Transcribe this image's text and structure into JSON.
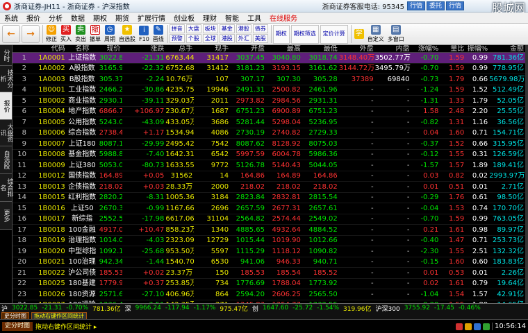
{
  "window": {
    "title": "浙商证券-JH11 - 浙商证券 - 沪深指数",
    "hotline": "浙商证券客服电话: 95345",
    "buttons": [
      "行情",
      "委托",
      "行情"
    ],
    "logo": "股城网"
  },
  "menubar": [
    "系统",
    "报价",
    "分析",
    "数据",
    "期权",
    "期货",
    "扩展行情",
    "创业板",
    "理财",
    "智能",
    "工具",
    "在线服务"
  ],
  "toolbar": {
    "big": [
      {
        "label": "←"
      },
      {
        "label": "→"
      }
    ],
    "icons": [
      {
        "label": "修正",
        "glyph": "☺",
        "color": "#f4a000"
      },
      {
        "label": "买入",
        "glyph": "买",
        "color": "#e02020"
      },
      {
        "label": "卖出",
        "glyph": "卖",
        "color": "#209020"
      },
      {
        "label": "撤单",
        "glyph": "撤",
        "color": "#ffffff"
      },
      {
        "label": "周期",
        "glyph": "◷",
        "color": "#2060c0"
      },
      {
        "label": "自选股",
        "glyph": "★",
        "color": "#f0c000"
      },
      {
        "label": "F10",
        "glyph": "i",
        "color": "#2060c0"
      },
      {
        "label": "画线",
        "glyph": "✎",
        "color": "#2060c0"
      }
    ],
    "pairs": [
      [
        "拼音",
        "预警"
      ],
      [
        "大盘",
        "个股"
      ],
      [
        "板块",
        "全球"
      ],
      [
        "基金",
        "港股"
      ],
      [
        "港股",
        "外汇"
      ],
      [
        "债券",
        "美股"
      ]
    ],
    "boxes": [
      "期权",
      "期权筛选",
      "定价计算"
    ],
    "tail": [
      {
        "label": "学",
        "glyph": "学"
      },
      {
        "label": "自定义",
        "glyph": "▦"
      },
      {
        "label": "多窗口",
        "glyph": "▤"
      }
    ]
  },
  "sidebar": [
    "分时",
    "技术分析",
    "报价",
    "大盘资讯",
    "自选股",
    "综合排名",
    "更多"
  ],
  "columns": [
    "",
    "代码",
    "名称",
    "现价",
    "涨跌",
    "总手",
    "现手",
    "开盘",
    "最高",
    "最低",
    "外盘",
    "内盘",
    "涨幅%",
    "量比",
    "振幅%",
    "金额"
  ],
  "rows": [
    [
      "1",
      "1A0001",
      "上证指数",
      "3022.85",
      "-21.31",
      "6763.44万",
      "31417",
      "3037.45",
      "3040.80",
      "3018.74",
      "3148.40万",
      "3502.77万",
      "-0.70",
      "1.59",
      "0.99",
      "781.36亿"
    ],
    [
      "2",
      "1A0002",
      "A股指数",
      "3165.94",
      "-22.32",
      "6752.68万",
      "31412",
      "3181.23",
      "3193.15",
      "3161.62",
      "3144.72万",
      "3495.79万",
      "-0.70",
      "1.59",
      "0.99",
      "778.95亿"
    ],
    [
      "3",
      "1A0003",
      "B股指数",
      "305.37",
      "-2.24",
      "10.76万",
      "107",
      "307.17",
      "307.30",
      "305.28",
      "37389",
      "69840",
      "-0.73",
      "1.79",
      "0.66",
      "5679.98万"
    ],
    [
      "4",
      "1B0001",
      "工业指数",
      "2466.22",
      "-30.86",
      "4235.75万",
      "19946",
      "2491.31",
      "2500.82",
      "2461.96",
      "-",
      "-",
      "-1.24",
      "1.59",
      "1.52",
      "512.49亿"
    ],
    [
      "5",
      "1B0002",
      "商业指数",
      "2930.18",
      "-39.11",
      "329.03万",
      "2011",
      "2973.82",
      "2984.56",
      "2931.31",
      "-",
      "-",
      "-1.31",
      "1.33",
      "1.79",
      "52.05亿"
    ],
    [
      "6",
      "1B0004",
      "地产指数",
      "6866.79",
      "+106.97",
      "230.67万",
      "1687",
      "6751.23",
      "6900.89",
      "6751.23",
      "-",
      "-",
      "1.58",
      "2.48",
      "2.20",
      "25.55亿"
    ],
    [
      "7",
      "1B0005",
      "公用指数",
      "5243.03",
      "-43.09",
      "433.05万",
      "3686",
      "5281.44",
      "5298.04",
      "5236.95",
      "-",
      "-",
      "-0.82",
      "1.31",
      "1.16",
      "36.56亿"
    ],
    [
      "8",
      "1B0006",
      "综合指数",
      "2738.44",
      "+1.17",
      "1534.94万",
      "4086",
      "2730.19",
      "2740.82",
      "2729.33",
      "-",
      "-",
      "0.04",
      "1.60",
      "0.71",
      "154.71亿"
    ],
    [
      "9",
      "1B0007",
      "上证180",
      "8087.12",
      "-29.99",
      "2495.42万",
      "7542",
      "8087.62",
      "8128.92",
      "8075.03",
      "-",
      "-",
      "-0.37",
      "1.52",
      "0.66",
      "315.95亿"
    ],
    [
      "10",
      "1B0008",
      "基金指数",
      "5988.84",
      "-7.40",
      "1642.31万",
      "6542",
      "5997.59",
      "6004.78",
      "5986.36",
      "-",
      "-",
      "-0.12",
      "1.55",
      "0.31",
      "126.59亿"
    ],
    [
      "11",
      "1B0009",
      "上证380",
      "5053.08",
      "-80.73",
      "1633.55万",
      "9772",
      "5126.78",
      "5140.43",
      "5044.05",
      "-",
      "-",
      "-1.57",
      "1.57",
      "1.89",
      "189.41亿"
    ],
    [
      "12",
      "1B0012",
      "国债指数",
      "164.89",
      "+0.05",
      "31562",
      "14",
      "164.86",
      "164.89",
      "164.86",
      "-",
      "-",
      "0.03",
      "0.82",
      "0.02",
      "2993.97万"
    ],
    [
      "13",
      "1B0013",
      "企债指数",
      "218.02",
      "+0.03",
      "28.33万",
      "2000",
      "218.02",
      "218.02",
      "218.02",
      "-",
      "-",
      "0.01",
      "0.51",
      "0.01",
      "2.71亿"
    ],
    [
      "14",
      "1B0015",
      "红利指数",
      "2820.23",
      "-8.31",
      "1005.36万",
      "3184",
      "2823.84",
      "2832.81",
      "2815.54",
      "-",
      "-",
      "-0.29",
      "1.76",
      "0.61",
      "98.50亿"
    ],
    [
      "15",
      "1B0016",
      "上证50",
      "2670.31",
      "-0.99",
      "1167.66万",
      "2696",
      "2657.59",
      "2677.31",
      "2657.61",
      "-",
      "-",
      "-0.04",
      "1.53",
      "0.74",
      "170.70亿"
    ],
    [
      "16",
      "1B0017",
      "新综指",
      "2552.51",
      "-17.98",
      "6617.06万",
      "31104",
      "2564.82",
      "2574.44",
      "2549.02",
      "-",
      "-",
      "-0.70",
      "1.59",
      "0.99",
      "763.05亿"
    ],
    [
      "17",
      "1B0018",
      "100金融",
      "4917.00",
      "+10.47",
      "858.23万",
      "1340",
      "4885.65",
      "4932.64",
      "4884.52",
      "-",
      "-",
      "0.21",
      "1.61",
      "0.98",
      "89.97亿"
    ],
    [
      "18",
      "1B0019",
      "治理指数",
      "1014.05",
      "-4.03",
      "2323.09万",
      "12729",
      "1015.44",
      "1019.90",
      "1012.66",
      "-",
      "-",
      "-0.40",
      "1.47",
      "0.71",
      "253.73亿"
    ],
    [
      "19",
      "1B0020",
      "中型综指",
      "1092.13",
      "-25.68",
      "953.50万",
      "5597",
      "1115.29",
      "1118.12",
      "1090.82",
      "-",
      "-",
      "-2.30",
      "1.55",
      "2.51",
      "132.32亿"
    ],
    [
      "20",
      "1B0021",
      "100治理",
      "942.34",
      "-1.44",
      "1540.70万",
      "6530",
      "941.06",
      "946.33",
      "940.71",
      "-",
      "-",
      "-0.15",
      "1.60",
      "0.60",
      "183.83亿"
    ],
    [
      "21",
      "1B0022",
      "沪公司债",
      "185.53",
      "+0.02",
      "23.37万",
      "150",
      "185.53",
      "185.54",
      "185.52",
      "-",
      "-",
      "0.01",
      "0.53",
      "0.01",
      "2.26亿"
    ],
    [
      "22",
      "1B0025",
      "180基建",
      "1779.92",
      "+0.37",
      "253.85万",
      "734",
      "1776.69",
      "1788.04",
      "1773.92",
      "-",
      "-",
      "0.02",
      "1.61",
      "0.79",
      "19.64亿"
    ],
    [
      "23",
      "1B0026",
      "180资源",
      "2571.69",
      "-27.10",
      "406.96万",
      "864",
      "2594.20",
      "2606.25",
      "2565.50",
      "-",
      "-",
      "-1.04",
      "1.54",
      "1.57",
      "42.91亿"
    ],
    [
      "24",
      "1B0027",
      "180运输",
      "1236.47",
      "-3.51",
      "142.35万",
      "271",
      "1245.83",
      "1254.77",
      "1232.55",
      "-",
      "-",
      "-0.28",
      "1.55",
      "1.80",
      "14.65亿"
    ]
  ],
  "status": {
    "items": [
      {
        "text": "沪",
        "cls": "wh"
      },
      {
        "text": "3022.85",
        "cls": "dn"
      },
      {
        "text": "-21.31",
        "cls": "dn"
      },
      {
        "text": "-0.70%",
        "cls": "dn"
      },
      {
        "text": "781.36亿",
        "cls": "yl"
      },
      {
        "text": "深",
        "cls": "wh"
      },
      {
        "text": "9966.24",
        "cls": "dn"
      },
      {
        "text": "-117.94",
        "cls": "dn"
      },
      {
        "text": "-1.17%",
        "cls": "dn"
      },
      {
        "text": "975.47亿",
        "cls": "yl"
      },
      {
        "text": "创",
        "cls": "wh"
      },
      {
        "text": "1647.60",
        "cls": "dn"
      },
      {
        "text": "-25.72",
        "cls": "dn"
      },
      {
        "text": "-1.54%",
        "cls": "dn"
      },
      {
        "text": "319.96亿",
        "cls": "yl"
      },
      {
        "text": "沪深300",
        "cls": "wh"
      },
      {
        "text": "3755.92",
        "cls": "dn"
      },
      {
        "text": "-17.45",
        "cls": "dn"
      },
      {
        "text": "-0.46%",
        "cls": "dn"
      }
    ],
    "tabs": [
      "史分时图",
      "拖动右键作区间统计"
    ],
    "tag": "史分时图",
    "message": "拖动右键作区间统计 ▸",
    "clock": "10:56:14"
  }
}
